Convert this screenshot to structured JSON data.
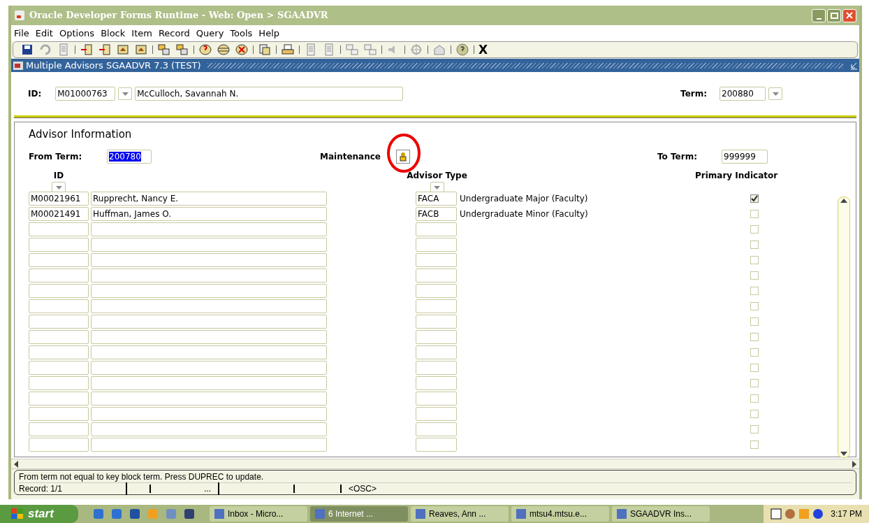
{
  "window": {
    "title": "Oracle Developer Forms Runtime - Web:  Open > SGAADVR"
  },
  "menu": [
    "File",
    "Edit",
    "Options",
    "Block",
    "Item",
    "Record",
    "Query",
    "Tools",
    "Help"
  ],
  "toolbar": {
    "exit_label": "X"
  },
  "form_title": "Multiple Advisors  SGAADVR  7.3  (TEST)",
  "key_block": {
    "id_label": "ID:",
    "id_value": "M01000763",
    "name_value": "McCulloch, Savannah N.",
    "term_label": "Term:",
    "term_value": "200880"
  },
  "section": {
    "title": "Advisor Information",
    "from_term_label": "From Term:",
    "from_term_value": "200780",
    "from_term_selected": true,
    "maintenance_label": "Maintenance",
    "to_term_label": "To Term:",
    "to_term_value": "999999"
  },
  "columns": {
    "id": "ID",
    "advisor_type": "Advisor Type",
    "primary": "Primary Indicator"
  },
  "rows": [
    {
      "id": "M00021961",
      "name": "Rupprecht, Nancy E.",
      "type_code": "FACA",
      "type_desc": "Undergraduate Major (Faculty)",
      "primary": true
    },
    {
      "id": "M00021491",
      "name": "Huffman, James O.",
      "type_code": "FACB",
      "type_desc": "Undergraduate Minor (Faculty)",
      "primary": false
    },
    {
      "primary": false
    },
    {
      "primary": false
    },
    {
      "primary": false
    },
    {
      "primary": false
    },
    {
      "primary": false
    },
    {
      "primary": false
    },
    {
      "primary": false
    },
    {
      "primary": false
    },
    {
      "primary": false
    },
    {
      "primary": false
    },
    {
      "primary": false
    },
    {
      "primary": false
    },
    {
      "primary": false
    },
    {
      "primary": false
    },
    {
      "primary": false
    }
  ],
  "status": {
    "message": "From term not equal to key block term.  Press DUPREC to update.",
    "record": "Record: 1/1",
    "field_3": "...",
    "field_6": "<OSC>"
  },
  "taskbar": {
    "start": "start",
    "tasks": [
      {
        "label": "Inbox - Micro...",
        "selected": false
      },
      {
        "label": "6  Internet ...",
        "selected": true
      },
      {
        "label": "Reaves, Ann ...",
        "selected": false
      },
      {
        "label": "mtsu4.mtsu.e...",
        "selected": false
      },
      {
        "label": "SGAADVR Ins...",
        "selected": false
      }
    ],
    "clock": "3:17 PM"
  }
}
